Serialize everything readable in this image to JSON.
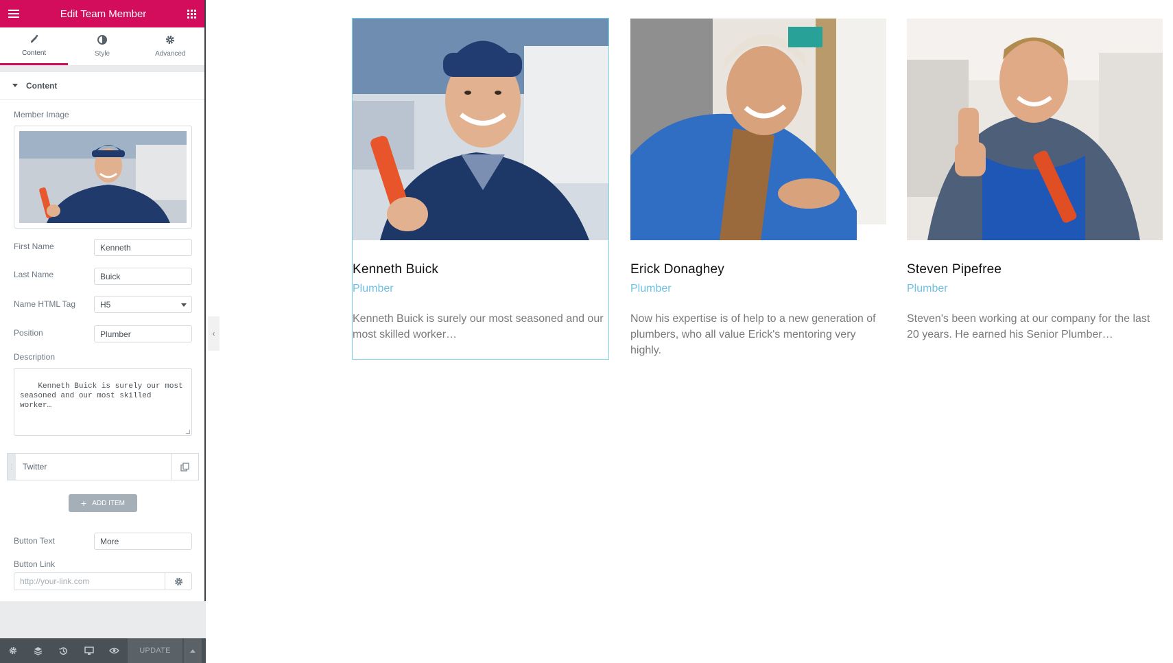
{
  "panel": {
    "title": "Edit Team Member",
    "tabs": [
      {
        "label": "Content",
        "icon": "pencil-icon"
      },
      {
        "label": "Style",
        "icon": "half-circle-icon"
      },
      {
        "label": "Advanced",
        "icon": "gear-icon"
      }
    ],
    "section_title": "Content",
    "fields": {
      "member_image_label": "Member Image",
      "first_name_label": "First Name",
      "first_name_value": "Kenneth",
      "last_name_label": "Last Name",
      "last_name_value": "Buick",
      "name_tag_label": "Name HTML Tag",
      "name_tag_value": "H5",
      "position_label": "Position",
      "position_value": "Plumber",
      "description_label": "Description",
      "description_value": "Kenneth Buick is surely our most\nseasoned and our most skilled\nworker…",
      "repeater_item": "Twitter",
      "add_item_label": "ADD ITEM",
      "button_text_label": "Button Text",
      "button_text_value": "More",
      "button_link_label": "Button Link",
      "button_link_placeholder": "http://your-link.com"
    },
    "footer": {
      "update_label": "UPDATE"
    }
  },
  "team": [
    {
      "name": "Kenneth Buick",
      "position": "Plumber",
      "description": "Kenneth Buick is surely our most seasoned and our most skilled worker…"
    },
    {
      "name": "Erick Donaghey",
      "position": "Plumber",
      "description": "Now his expertise is of help to a new generation of plumbers, who all value Erick's mentoring very highly."
    },
    {
      "name": "Steven Pipefree",
      "position": "Plumber",
      "description": "Steven's been working at our company for the last 20 years. He earned his Senior Plumber…"
    }
  ],
  "colors": {
    "accent": "#d30c5c",
    "position_text": "#6ec1e4",
    "footer_bg": "#495157"
  }
}
